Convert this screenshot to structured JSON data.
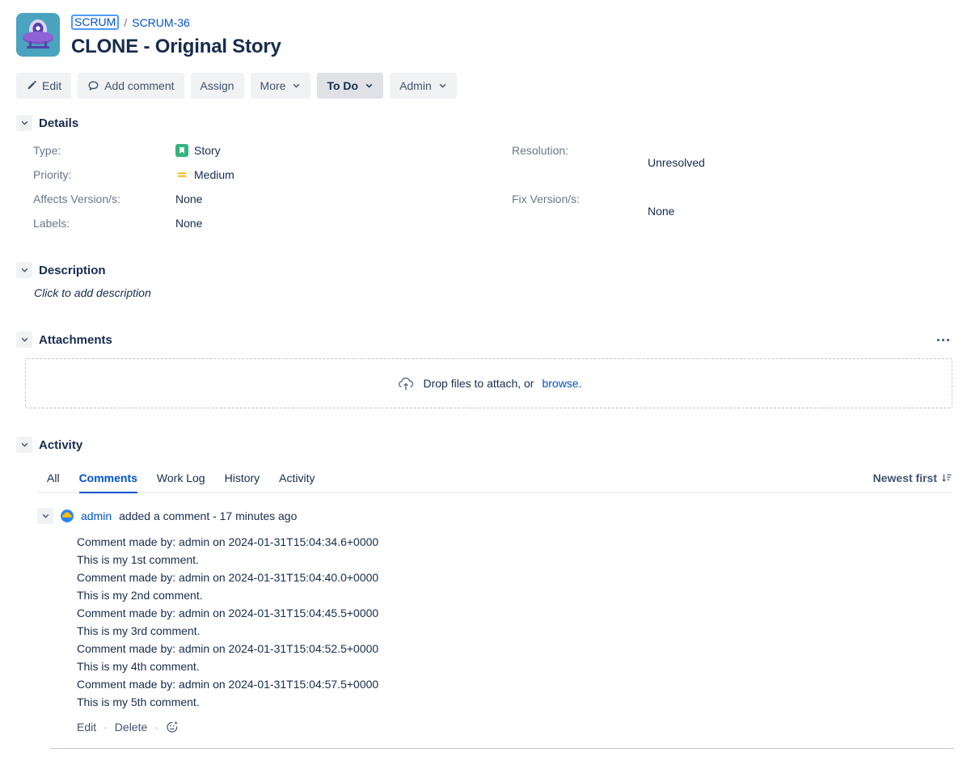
{
  "header": {
    "project_avatar_icon": "ufo-spaceship-icon",
    "breadcrumb_project": "SCRUM",
    "breadcrumb_separator": "/",
    "breadcrumb_issue": "SCRUM-36",
    "issue_title": "CLONE - Original Story"
  },
  "toolbar": {
    "edit_label": "Edit",
    "add_comment_label": "Add comment",
    "assign_label": "Assign",
    "more_label": "More",
    "status_label": "To Do",
    "admin_label": "Admin"
  },
  "details": {
    "section_title": "Details",
    "left_fields": [
      {
        "label": "Type:",
        "value": "Story",
        "icon": "story-icon"
      },
      {
        "label": "Priority:",
        "value": "Medium",
        "icon": "priority-medium-icon"
      },
      {
        "label": "Affects Version/s:",
        "value": "None",
        "icon": ""
      },
      {
        "label": "Labels:",
        "value": "None",
        "icon": ""
      }
    ],
    "right_fields": [
      {
        "label": "Resolution:",
        "value": "Unresolved"
      },
      {
        "label": "Fix Version/s:",
        "value": "None"
      }
    ]
  },
  "description": {
    "section_title": "Description",
    "placeholder": "Click to add description"
  },
  "attachments": {
    "section_title": "Attachments",
    "menu_icon": "ellipsis-icon",
    "dropzone_icon": "cloud-upload-icon",
    "dropzone_text": "Drop files to attach, or",
    "dropzone_link": "browse."
  },
  "activity": {
    "section_title": "Activity",
    "tabs": [
      {
        "label": "All",
        "active": false
      },
      {
        "label": "Comments",
        "active": true
      },
      {
        "label": "Work Log",
        "active": false
      },
      {
        "label": "History",
        "active": false
      },
      {
        "label": "Activity",
        "active": false
      }
    ],
    "sort_label": "Newest first",
    "sort_icon": "sort-descending-icon",
    "comment": {
      "author": "admin",
      "meta": "added a comment - 17 minutes ago",
      "avatar_icon": "user-avatar-cloud-icon",
      "body": "Comment made by: admin on 2024-01-31T15:04:34.6+0000\nThis is my 1st comment.\nComment made by: admin on 2024-01-31T15:04:40.0+0000\nThis is my 2nd comment.\nComment made by: admin on 2024-01-31T15:04:45.5+0000\nThis is my 3rd comment.\nComment made by: admin on 2024-01-31T15:04:52.5+0000\nThis is my 4th comment.\nComment made by: admin on 2024-01-31T15:04:57.5+0000\nThis is my 5th comment.",
      "edit_label": "Edit",
      "delete_label": "Delete",
      "separator": "·",
      "reaction_icon": "add-reaction-icon"
    }
  },
  "colors": {
    "link": "#0052cc",
    "text": "#172b4d",
    "muted": "#6b778c",
    "button_bg": "#f1f2f4",
    "status_bg": "#dfe1e6",
    "story_green": "#36b37e",
    "priority_orange": "#ffab00",
    "avatar_teal": "#4aa3bf"
  }
}
